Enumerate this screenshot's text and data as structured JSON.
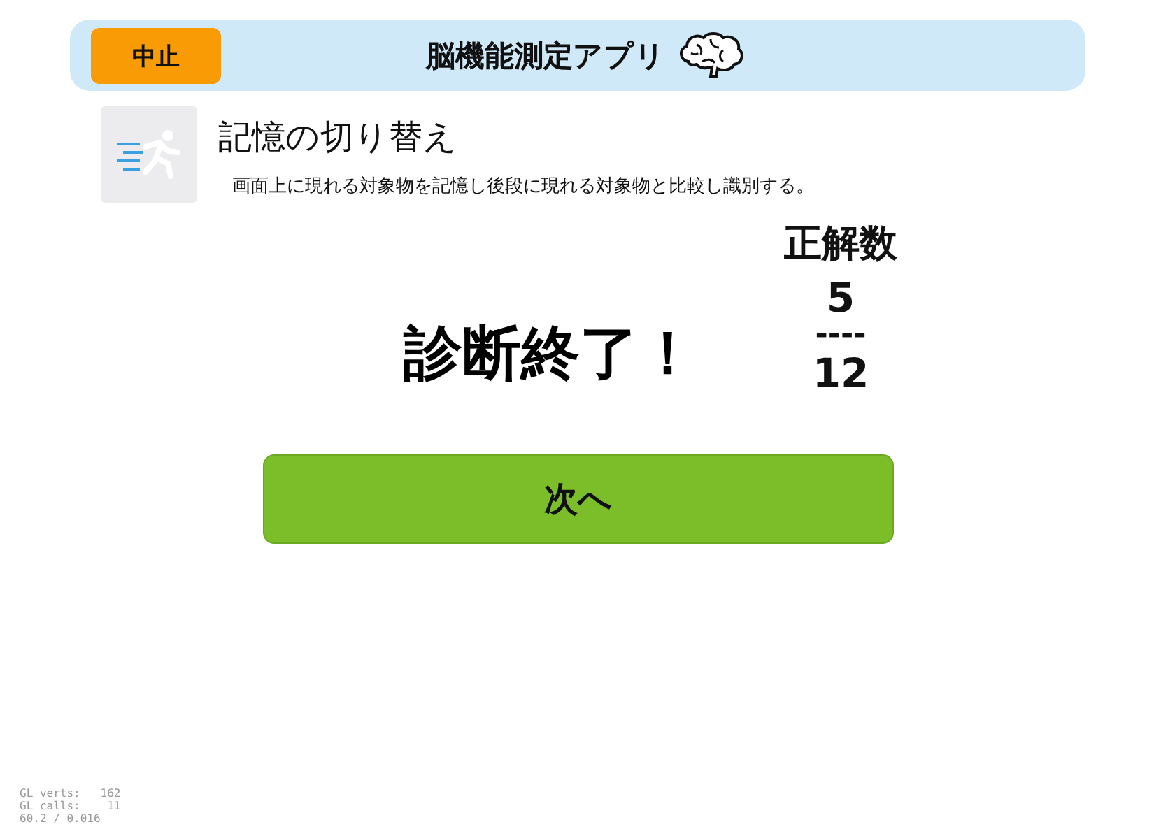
{
  "header": {
    "abort_button": "中止",
    "title": "脳機能測定アプリ"
  },
  "task": {
    "name": "記憶の切り替え",
    "description": "画面上に現れる対象物を記憶し後段に現れる対象物と比較し識別する。"
  },
  "result": {
    "message": "診断終了！",
    "score_label": "正解数",
    "correct": "5",
    "divider": "----",
    "total": "12"
  },
  "next_button": "次へ",
  "debug_overlay": [
    "GL verts:   162",
    "GL calls:    11",
    "60.2 / 0.016"
  ]
}
